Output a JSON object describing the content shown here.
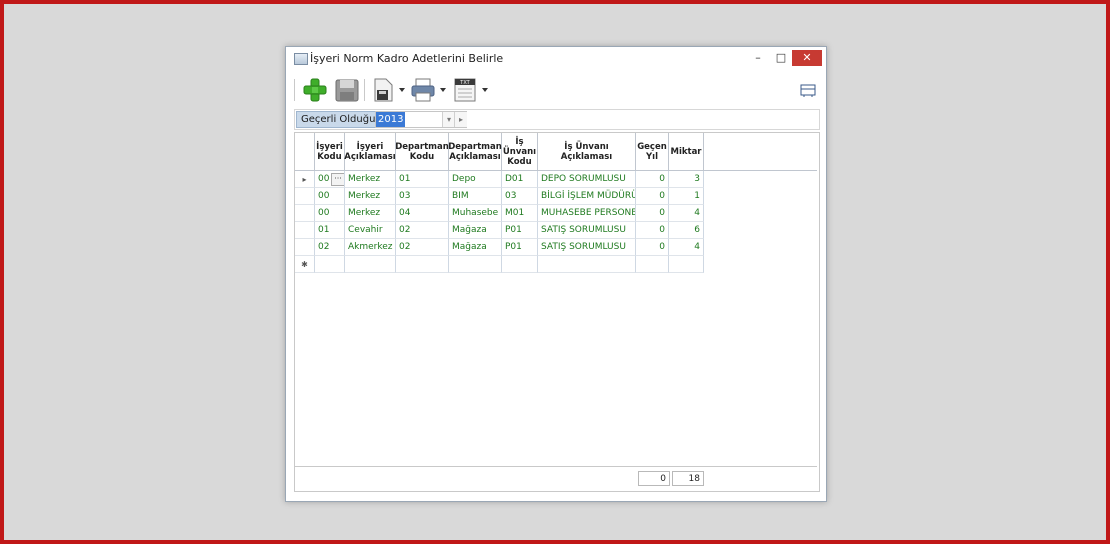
{
  "window": {
    "title": "İşyeri Norm Kadro Adetlerini Belirle"
  },
  "titlebar_buttons": {
    "minimize": "–",
    "maximize": "□",
    "close": "✕"
  },
  "toolbar": {
    "buttons": [
      "add-icon",
      "save-icon",
      "save-as-icon",
      "print-icon",
      "export-txt-icon"
    ],
    "export_label": "TXT"
  },
  "filter": {
    "label": "Geçerli Olduğu Yıl",
    "value": "2013"
  },
  "grid": {
    "columns": [
      "İşyeri Kodu",
      "İşyeri Açıklaması",
      "Departman Kodu",
      "Departman Açıklaması",
      "İş Ünvanı Kodu",
      "İş Ünvanı Açıklaması",
      "Geçen Yıl",
      "Miktar"
    ],
    "rows": [
      [
        "00",
        "Merkez",
        "01",
        "Depo",
        "D01",
        "DEPO SORUMLUSU",
        "0",
        "3"
      ],
      [
        "00",
        "Merkez",
        "03",
        "BIM",
        "03",
        "BİLGİ İŞLEM MÜDÜRÜ",
        "0",
        "1"
      ],
      [
        "00",
        "Merkez",
        "04",
        "Muhasebe",
        "M01",
        "MUHASEBE PERSONELİ",
        "0",
        "4"
      ],
      [
        "01",
        "Cevahir",
        "02",
        "Mağaza",
        "P01",
        "SATIŞ SORUMLUSU",
        "0",
        "6"
      ],
      [
        "02",
        "Akmerkez",
        "02",
        "Mağaza",
        "P01",
        "SATIŞ SORUMLUSU",
        "0",
        "4"
      ]
    ],
    "ellipsis": "···",
    "current_row_indicator": "▸",
    "new_row_indicator": "✱",
    "totals": {
      "gecen_yil": "0",
      "miktar": "18"
    }
  },
  "colors": {
    "frame_border": "#c01818",
    "cell_text": "#1f7a1f",
    "selection": "#3b7ad6"
  }
}
